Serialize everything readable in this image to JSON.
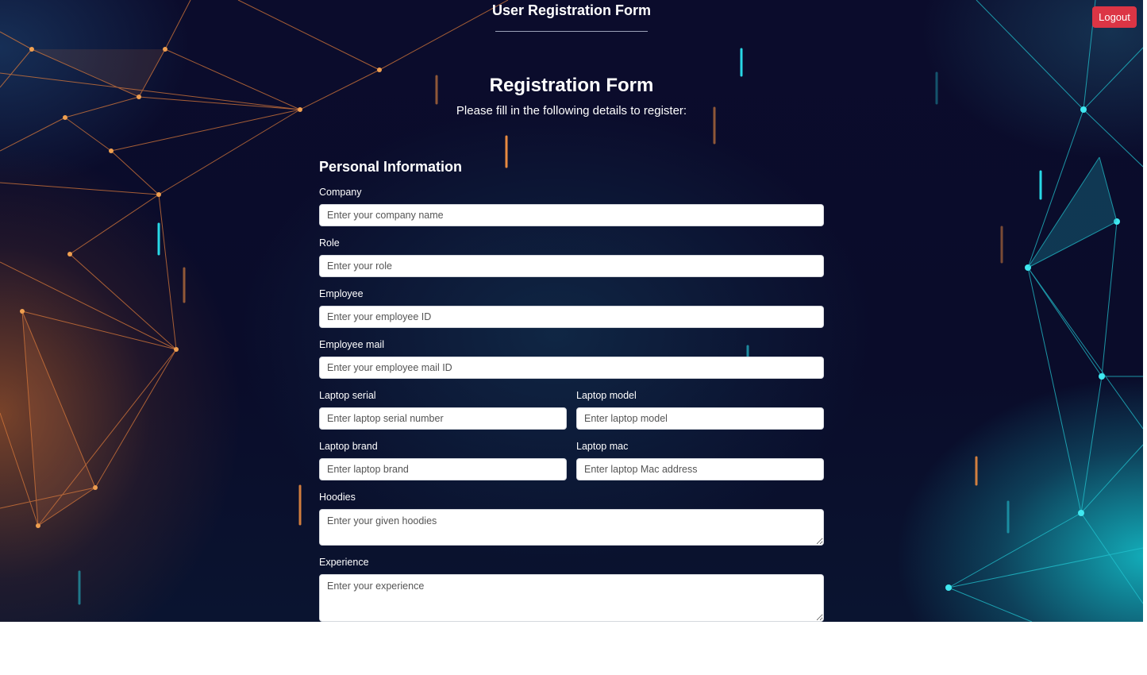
{
  "header": {
    "title": "User Registration Form",
    "logout_label": "Logout"
  },
  "form": {
    "title": "Registration Form",
    "subtitle": "Please fill in the following details to register:",
    "section_heading": "Personal Information",
    "fields": {
      "company": {
        "label": "Company",
        "placeholder": "Enter your company name"
      },
      "role": {
        "label": "Role",
        "placeholder": "Enter your role"
      },
      "employee": {
        "label": "Employee",
        "placeholder": "Enter your employee ID"
      },
      "employee_mail": {
        "label": "Employee mail",
        "placeholder": "Enter your employee mail ID"
      },
      "laptop_serial": {
        "label": "Laptop serial",
        "placeholder": "Enter laptop serial number"
      },
      "laptop_model": {
        "label": "Laptop model",
        "placeholder": "Enter laptop model"
      },
      "laptop_brand": {
        "label": "Laptop brand",
        "placeholder": "Enter laptop brand"
      },
      "laptop_mac": {
        "label": "Laptop mac",
        "placeholder": "Enter laptop Mac address"
      },
      "hoodies": {
        "label": "Hoodies",
        "placeholder": "Enter your given hoodies"
      },
      "experience": {
        "label": "Experience",
        "placeholder": "Enter your experience"
      }
    }
  },
  "colors": {
    "logout_button": "#dc3545",
    "background_dark": "#0b0c2c",
    "accent_teal": "#18c8d2",
    "accent_orange": "#e07a2c"
  }
}
